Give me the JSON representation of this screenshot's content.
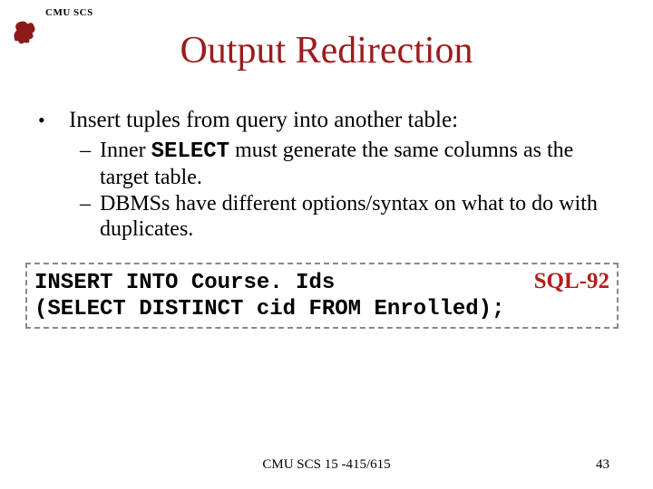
{
  "header": {
    "dept": "CMU SCS"
  },
  "title": "Output Redirection",
  "bullet": {
    "main": "Insert tuples from query into another table:",
    "sub1_a": "Inner ",
    "sub1_code": "SELECT",
    "sub1_b": " must generate the same columns as the target table.",
    "sub2": "DBMSs have different options/syntax on what to do with duplicates."
  },
  "code": {
    "line1": "INSERT INTO Course. Ids",
    "tag": "SQL-92",
    "line2": "(SELECT DISTINCT cid FROM Enrolled);"
  },
  "footer": {
    "center": "CMU SCS 15 -415/615",
    "page": "43"
  }
}
